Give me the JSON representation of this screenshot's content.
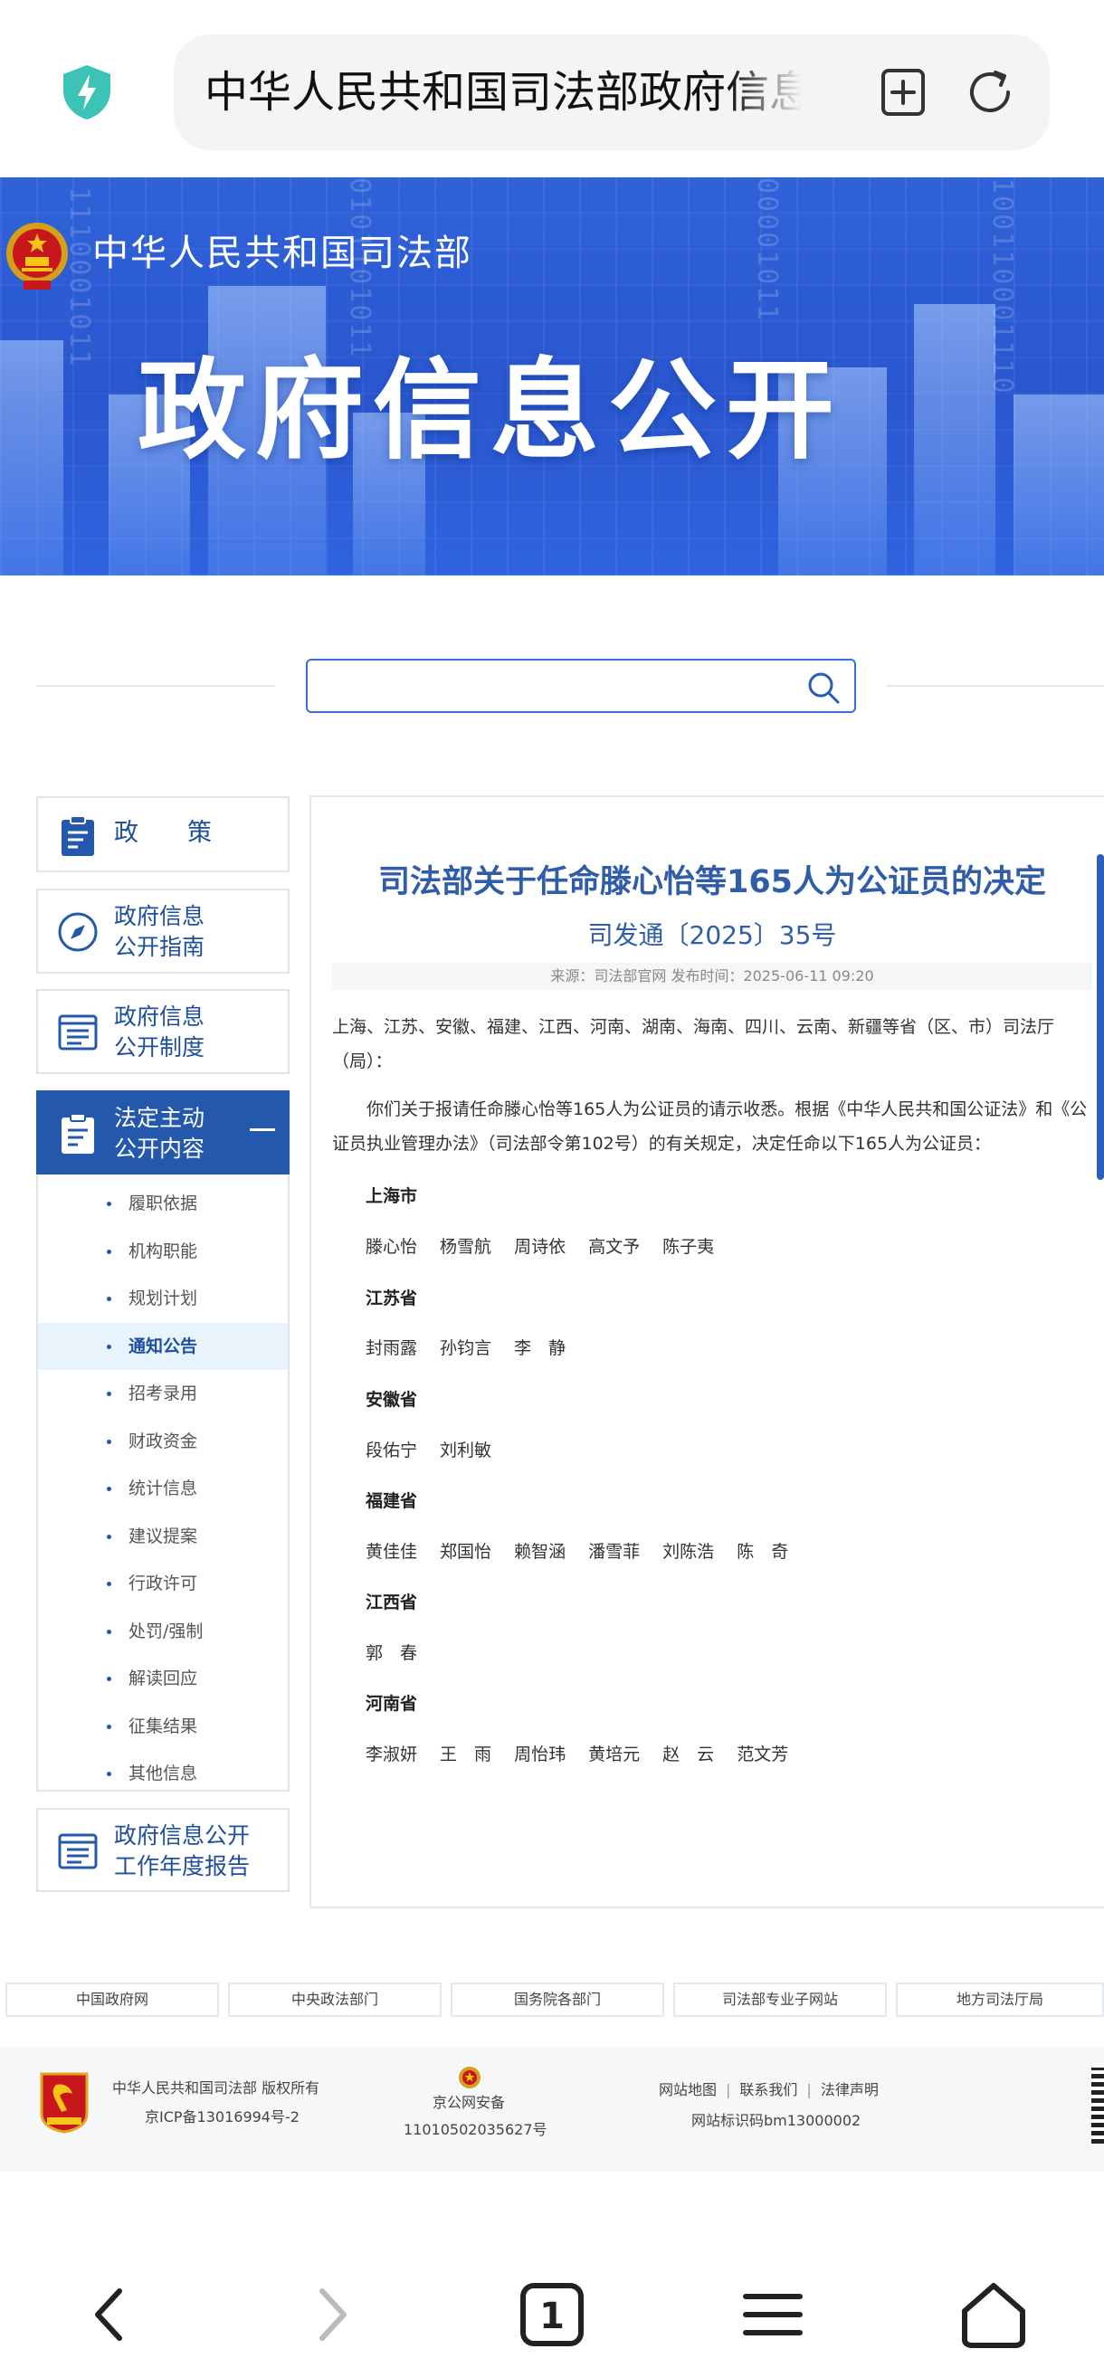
{
  "browser": {
    "url_text": "中华人民共和国司法部政府信息公开",
    "tabs_count": "1"
  },
  "banner": {
    "site_name": "中华人民共和国司法部",
    "title": "政府信息公开"
  },
  "search": {
    "value": ""
  },
  "sidebar": {
    "policy_label": "政　　策",
    "guide_label": [
      "政府信息",
      "公开指南"
    ],
    "system_label": [
      "政府信息",
      "公开制度"
    ],
    "active_label": [
      "法定主动",
      "公开内容"
    ],
    "sub_items": [
      "履职依据",
      "机构职能",
      "规划计划",
      "通知公告",
      "招考录用",
      "财政资金",
      "统计信息",
      "建议提案",
      "行政许可",
      "处罚/强制",
      "解读回应",
      "征集结果",
      "其他信息"
    ],
    "selected_sub": "通知公告",
    "report_label": [
      "政府信息公开",
      "工作年度报告"
    ]
  },
  "article": {
    "title": "司法部关于任命滕心怡等165人为公证员的决定",
    "doc_no": "司发通〔2025〕35号",
    "meta": "来源：司法部官网  发布时间：2025-06-11 09:20",
    "addressee": "上海、江苏、安徽、福建、江西、河南、湖南、海南、四川、云南、新疆等省（区、市）司法厅（局）：",
    "body": "你们关于报请任命滕心怡等165人为公证员的请示收悉。根据《中华人民共和国公证法》和《公证员执业管理办法》（司法部令第102号）的有关规定，决定任命以下165人为公证员：",
    "provinces": [
      {
        "name": "上海市",
        "people": [
          "滕心怡",
          "杨雪航",
          "周诗依",
          "高文予",
          "陈子夷"
        ]
      },
      {
        "name": "江苏省",
        "people": [
          "封雨露",
          "孙钧言",
          "李　静"
        ]
      },
      {
        "name": "安徽省",
        "people": [
          "段佑宁",
          "刘利敏"
        ]
      },
      {
        "name": "福建省",
        "people": [
          "黄佳佳",
          "郑国怡",
          "赖智涵",
          "潘雪菲",
          "刘陈浩",
          "陈　奇"
        ]
      },
      {
        "name": "江西省",
        "people": [
          "郭　春"
        ]
      },
      {
        "name": "河南省",
        "people": [
          "李淑妍",
          "王　雨",
          "周怡玮",
          "黄培元",
          "赵　云",
          "范文芳"
        ]
      }
    ]
  },
  "footer_links": [
    "中国政府网",
    "中央政法部门",
    "国务院各部门",
    "司法部专业子网站",
    "地方司法厅局"
  ],
  "footer": {
    "copyright": "中华人民共和国司法部 版权所有",
    "icp": "京ICP备13016994号-2",
    "police_line1": "京公网安备",
    "police_line2": "11010502035627号",
    "link_sitemap": "网站地图",
    "link_contact": "联系我们",
    "link_legal": "法律声明",
    "site_id": "网站标识码bm13000002"
  },
  "colors": {
    "brand_blue": "#2358ad",
    "title_blue": "#2f5da9",
    "banner_blue": "#2f62d8",
    "shield_teal": "#3cc3b6"
  }
}
